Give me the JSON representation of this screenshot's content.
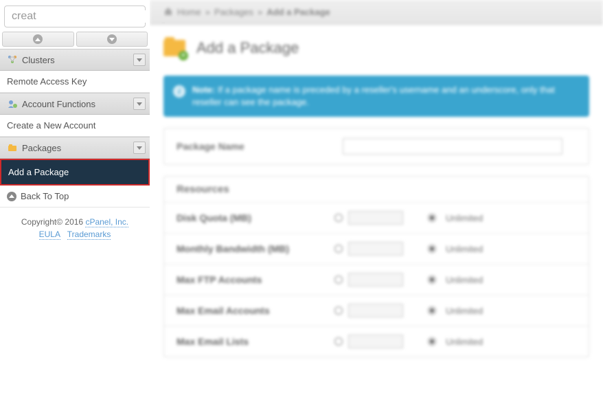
{
  "search": {
    "value": "creat"
  },
  "sidebar": {
    "sections": [
      {
        "label": "Clusters"
      },
      {
        "label": "Remote Access Key"
      },
      {
        "label": "Account Functions"
      },
      {
        "label": "Create a New Account"
      },
      {
        "label": "Packages"
      },
      {
        "label": "Add a Package"
      }
    ],
    "back": "Back To Top"
  },
  "footer": {
    "copy": "Copyright© 2016",
    "company": "cPanel, Inc.",
    "eula": "EULA",
    "trademarks": "Trademarks"
  },
  "breadcrumb": {
    "home": "Home",
    "sep": "»",
    "packages": "Packages",
    "current": "Add a Package"
  },
  "page_title": "Add a Package",
  "note": {
    "bold": "Note:",
    "text": "If a package name is preceded by a reseller's username and an underscore, only that reseller can see the package."
  },
  "package_name": {
    "label": "Package Name"
  },
  "resources": {
    "title": "Resources",
    "rows": [
      {
        "label": "Disk Quota (MB)",
        "unlimited": "Unlimited"
      },
      {
        "label": "Monthly Bandwidth (MB)",
        "unlimited": "Unlimited"
      },
      {
        "label": "Max FTP Accounts",
        "unlimited": "Unlimited"
      },
      {
        "label": "Max Email Accounts",
        "unlimited": "Unlimited"
      },
      {
        "label": "Max Email Lists",
        "unlimited": "Unlimited"
      }
    ]
  }
}
